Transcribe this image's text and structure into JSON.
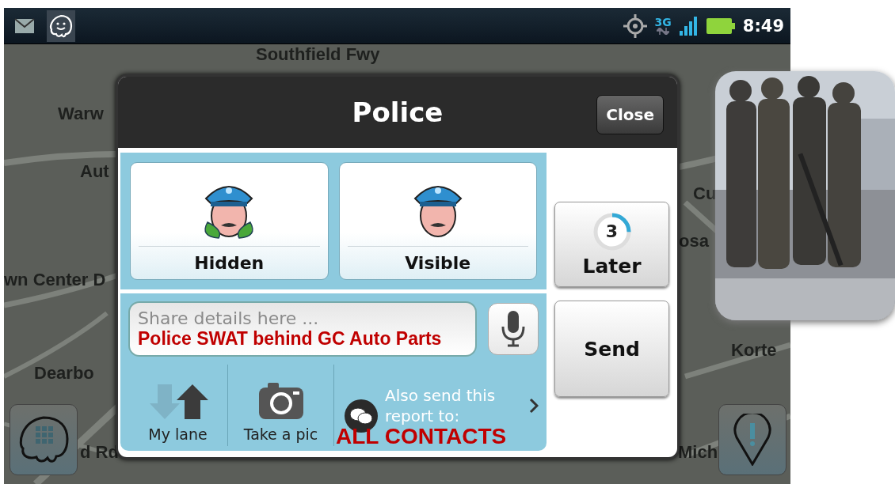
{
  "status_bar": {
    "notification_icons": [
      {
        "kind": "mail",
        "selected": false
      },
      {
        "kind": "app",
        "selected": true
      }
    ],
    "network": "3G",
    "time": "8:49"
  },
  "map": {
    "labels": [
      {
        "text": "Southfield Fwy"
      },
      {
        "text": "Warw"
      },
      {
        "text": "Aut"
      },
      {
        "text": "wn Center D"
      },
      {
        "text": "Dearbo"
      },
      {
        "text": "d Rd"
      },
      {
        "text": "Cu"
      },
      {
        "text": "osa"
      },
      {
        "text": "Korte"
      },
      {
        "text": "Mich"
      }
    ]
  },
  "dialog": {
    "title": "Police",
    "close_button": "Close",
    "options": [
      {
        "kind": "hidden",
        "label": "Hidden"
      },
      {
        "kind": "visible",
        "label": "Visible"
      }
    ],
    "details_field": {
      "placeholder": "Share details here ...",
      "annotation": "Police SWAT behind GC Auto Parts"
    },
    "actions": [
      {
        "kind": "lane",
        "label": "My lane"
      },
      {
        "kind": "camera",
        "label": "Take a pic"
      }
    ],
    "share": {
      "text": "Also send this report to:",
      "annotation": "ALL CONTACTS"
    },
    "later_button": {
      "countdown": "3",
      "label": "Later",
      "level": 0.25
    },
    "send_button": "Send"
  }
}
